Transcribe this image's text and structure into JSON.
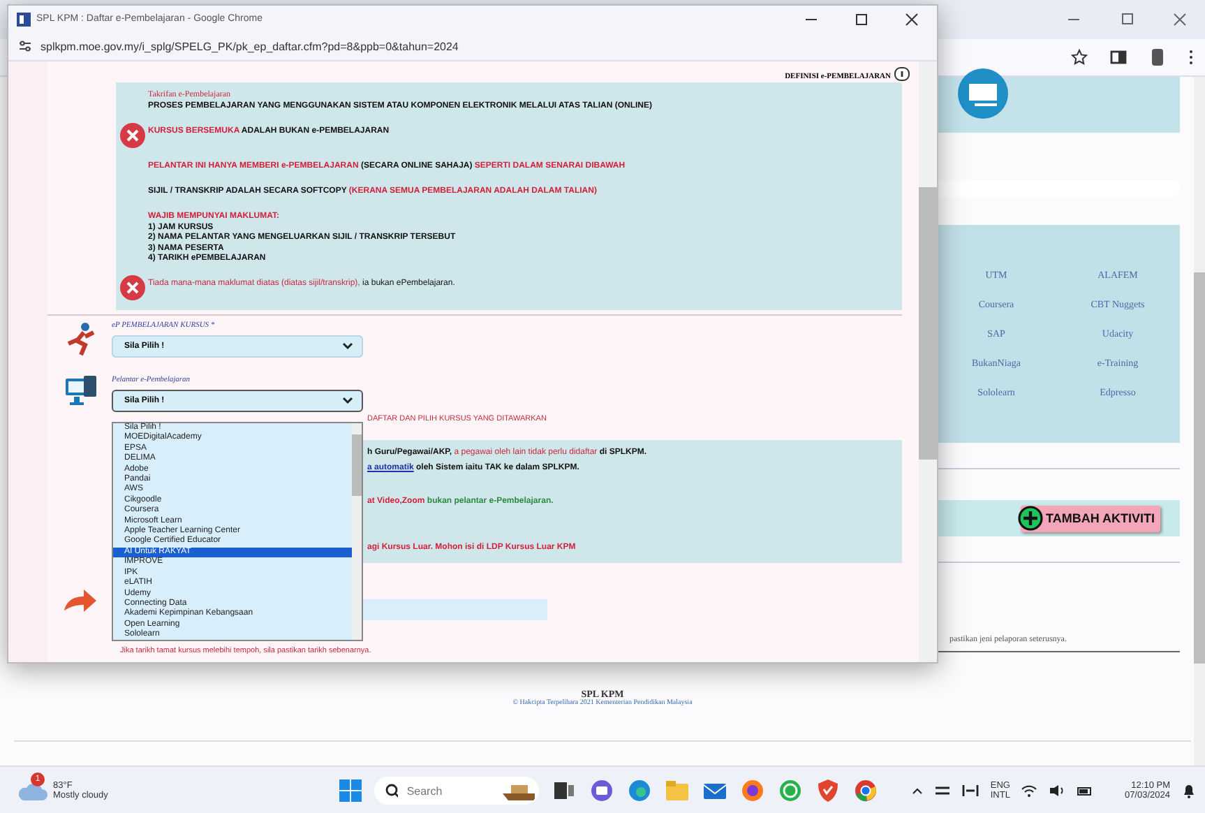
{
  "background_window": {
    "providers": [
      {
        "label": "UTM"
      },
      {
        "label": "ALAFEM"
      },
      {
        "label": "Coursera"
      },
      {
        "label": "CBT Nuggets"
      },
      {
        "label": "SAP"
      },
      {
        "label": "Udacity"
      },
      {
        "label": "BukanNiaga"
      },
      {
        "label": "e-Training"
      },
      {
        "label": "Sololearn"
      },
      {
        "label": "Edpresso"
      }
    ],
    "add_button": "TAMBAH AKTIVITI",
    "note": "pastikan jeni pelaporan seterusnya.",
    "footer": {
      "title": "SPL KPM",
      "copyright": "© Hakcipta Terpelihara 2021 Kementerian Pendidikan Malaysia"
    }
  },
  "popup": {
    "title": "SPL KPM : Daftar e-Pembelajaran - Google Chrome",
    "url": "splkpm.moe.gov.my/i_splg/SPELG_PK/pk_ep_daftar.cfm?pd=8&ppb=0&tahun=2024",
    "definition_label": "DEFINISI e-PEMBELAJARAN",
    "info_blocks": [
      {
        "marked": false,
        "lines": [
          [
            {
              "kind": "caption",
              "text": "Takrifan e-Pembelajaran"
            }
          ],
          [
            {
              "kind": "plain",
              "text": "PROSES PEMBELAJARAN YANG MENGGUNAKAN SISTEM ATAU KOMPONEN ELEKTRONIK MELALUI ATAS TALIAN (ONLINE)"
            }
          ]
        ]
      },
      {
        "marked": true,
        "lines": [
          [
            {
              "kind": "alert",
              "text": "KURSUS BERSEMUKA "
            },
            {
              "kind": "plain",
              "text": "ADALAH BUKAN e-PEMBELAJARAN"
            }
          ]
        ]
      },
      {
        "marked": false,
        "lines": [
          [
            {
              "kind": "alert",
              "text": "PELANTAR INI HANYA MEMBERI e-PEMBELAJARAN "
            },
            {
              "kind": "plain",
              "text": "(SECARA ONLINE SAHAJA) "
            },
            {
              "kind": "alert",
              "text": "SEPERTI DALAM SENARAI DIBAWAH"
            }
          ]
        ]
      },
      {
        "marked": false,
        "lines": [
          [
            {
              "kind": "plain",
              "text": "SIJIL / TRANSKRIP ADALAH SECARA SOFTCOPY "
            },
            {
              "kind": "alert",
              "text": "(KERANA SEMUA PEMBELAJARAN ADALAH DALAM TALIAN)"
            }
          ]
        ]
      },
      {
        "marked": false,
        "lines": [
          [
            {
              "kind": "alert",
              "text": "WAJIB MEMPUNYAI MAKLUMAT:"
            }
          ],
          [
            {
              "kind": "plain",
              "text": "1) JAM KURSUS"
            }
          ],
          [
            {
              "kind": "plain",
              "text": "2) NAMA PELANTAR YANG MENGELUARKAN SIJIL / TRANSKRIP TERSEBUT"
            }
          ],
          [
            {
              "kind": "plain",
              "text": "3) NAMA PESERTA"
            }
          ],
          [
            {
              "kind": "plain",
              "text": "4) TARIKH ePEMBELAJARAN"
            }
          ]
        ]
      },
      {
        "marked": true,
        "lines": [
          [
            {
              "kind": "soft_alert",
              "text": "Tiada mana-mana maklumat diatas (diatas sijil/transkrip), "
            },
            {
              "kind": "plain_normal",
              "text": "ia bukan ePembelajaran."
            }
          ]
        ]
      }
    ],
    "fields": [
      {
        "kind": "runner",
        "label": "eP PEMBELAJARAN KURSUS *",
        "value": "Sila Pilih !",
        "open": false
      },
      {
        "kind": "computer",
        "label": "Pelantar e-Pembelajaran",
        "value": "Sila Pilih !",
        "open": true
      }
    ],
    "dropdown_options": [
      {
        "label": "Sila Pilih !",
        "selected": false
      },
      {
        "label": "MOEDigitalAcademy",
        "selected": false
      },
      {
        "label": "EPSA",
        "selected": false
      },
      {
        "label": "DELIMA",
        "selected": false
      },
      {
        "label": "Adobe",
        "selected": false
      },
      {
        "label": "Pandai",
        "selected": false
      },
      {
        "label": "AWS",
        "selected": false
      },
      {
        "label": "Cikgoodle",
        "selected": false
      },
      {
        "label": "Coursera",
        "selected": false
      },
      {
        "label": "Microsoft Learn",
        "selected": false
      },
      {
        "label": "Apple Teacher Learning Center",
        "selected": false
      },
      {
        "label": "Google Certified Educator",
        "selected": false
      },
      {
        "label": "AI Untuk RAKYAT",
        "selected": true
      },
      {
        "label": "IMPROVE",
        "selected": false
      },
      {
        "label": "IPK",
        "selected": false
      },
      {
        "label": "eLATIH",
        "selected": false
      },
      {
        "label": "Udemy",
        "selected": false
      },
      {
        "label": "Connecting Data",
        "selected": false
      },
      {
        "label": "Akademi Kepimpinan Kebangsaan",
        "selected": false
      },
      {
        "label": "Open Learning",
        "selected": false
      },
      {
        "label": "Sololearn",
        "selected": false
      }
    ],
    "register_hint": "DAFTAR DAN PILIH KURSUS YANG DITAWARKAN",
    "note_lines": [
      [
        {
          "kind": "plain",
          "text": "h Guru/Pegawai/AKP, "
        },
        {
          "kind": "soft_alert",
          "text": "a pegawai oleh lain tidak perlu didaftar "
        },
        {
          "kind": "plain",
          "text": "di SPLKPM."
        }
      ],
      [
        {
          "kind": "link",
          "text": "a automatik"
        },
        {
          "kind": "plain",
          "text": " oleh Sistem iaitu TAK ke dalam SPLKPM."
        }
      ],
      [
        {
          "kind": "alert",
          "text": "at Video,Zoom "
        },
        {
          "kind": "good",
          "text": "bukan pelantar e-Pembelajaran."
        }
      ],
      [
        {
          "kind": "alert",
          "text": "agi Kursus Luar. Mohon isi di LDP Kursus Luar KPM"
        }
      ]
    ],
    "bottom_note": "Jika tarikh tamat kursus melebihi tempoh, sila pastikan tarikh sebenarnya."
  },
  "taskbar": {
    "weather": {
      "badge": "1",
      "temperature": "83°F",
      "condition": "Mostly cloudy"
    },
    "search_placeholder": "Search",
    "language": [
      "ENG",
      "INTL"
    ],
    "time": "12:10 PM",
    "date": "07/03/2024"
  }
}
